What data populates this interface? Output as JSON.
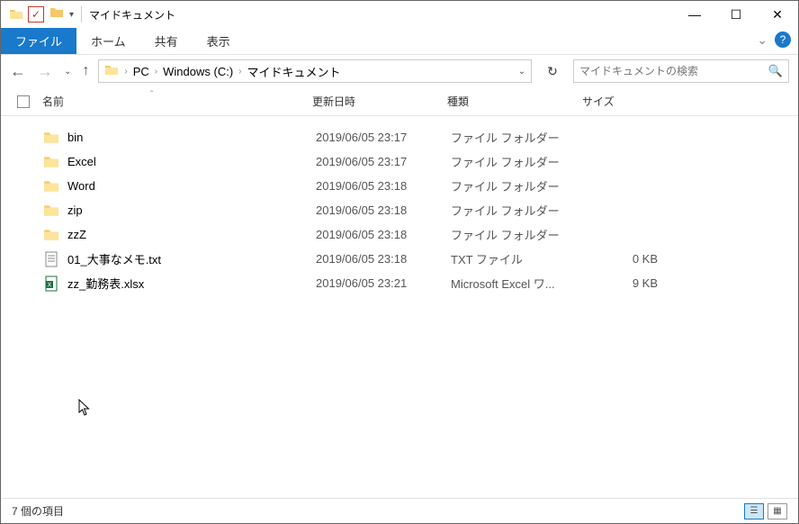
{
  "window": {
    "title": "マイドキュメント"
  },
  "ribbon": {
    "tabs": [
      {
        "label": "ファイル",
        "active": true
      },
      {
        "label": "ホーム",
        "active": false
      },
      {
        "label": "共有",
        "active": false
      },
      {
        "label": "表示",
        "active": false
      }
    ]
  },
  "breadcrumb": {
    "parts": [
      "PC",
      "Windows (C:)",
      "マイドキュメント"
    ]
  },
  "search": {
    "placeholder": "マイドキュメントの検索"
  },
  "columns": {
    "name": "名前",
    "date": "更新日時",
    "type": "種類",
    "size": "サイズ"
  },
  "items": [
    {
      "icon": "folder",
      "name": "bin",
      "date": "2019/06/05 23:17",
      "type": "ファイル フォルダー",
      "size": ""
    },
    {
      "icon": "folder",
      "name": "Excel",
      "date": "2019/06/05 23:17",
      "type": "ファイル フォルダー",
      "size": ""
    },
    {
      "icon": "folder",
      "name": "Word",
      "date": "2019/06/05 23:18",
      "type": "ファイル フォルダー",
      "size": ""
    },
    {
      "icon": "folder",
      "name": "zip",
      "date": "2019/06/05 23:18",
      "type": "ファイル フォルダー",
      "size": ""
    },
    {
      "icon": "folder",
      "name": "zzZ",
      "date": "2019/06/05 23:18",
      "type": "ファイル フォルダー",
      "size": ""
    },
    {
      "icon": "txt",
      "name": "01_大事なメモ.txt",
      "date": "2019/06/05 23:18",
      "type": "TXT ファイル",
      "size": "0 KB"
    },
    {
      "icon": "xlsx",
      "name": "zz_勤務表.xlsx",
      "date": "2019/06/05 23:21",
      "type": "Microsoft Excel ワ...",
      "size": "9 KB"
    }
  ],
  "status": {
    "text": "7 個の項目"
  }
}
